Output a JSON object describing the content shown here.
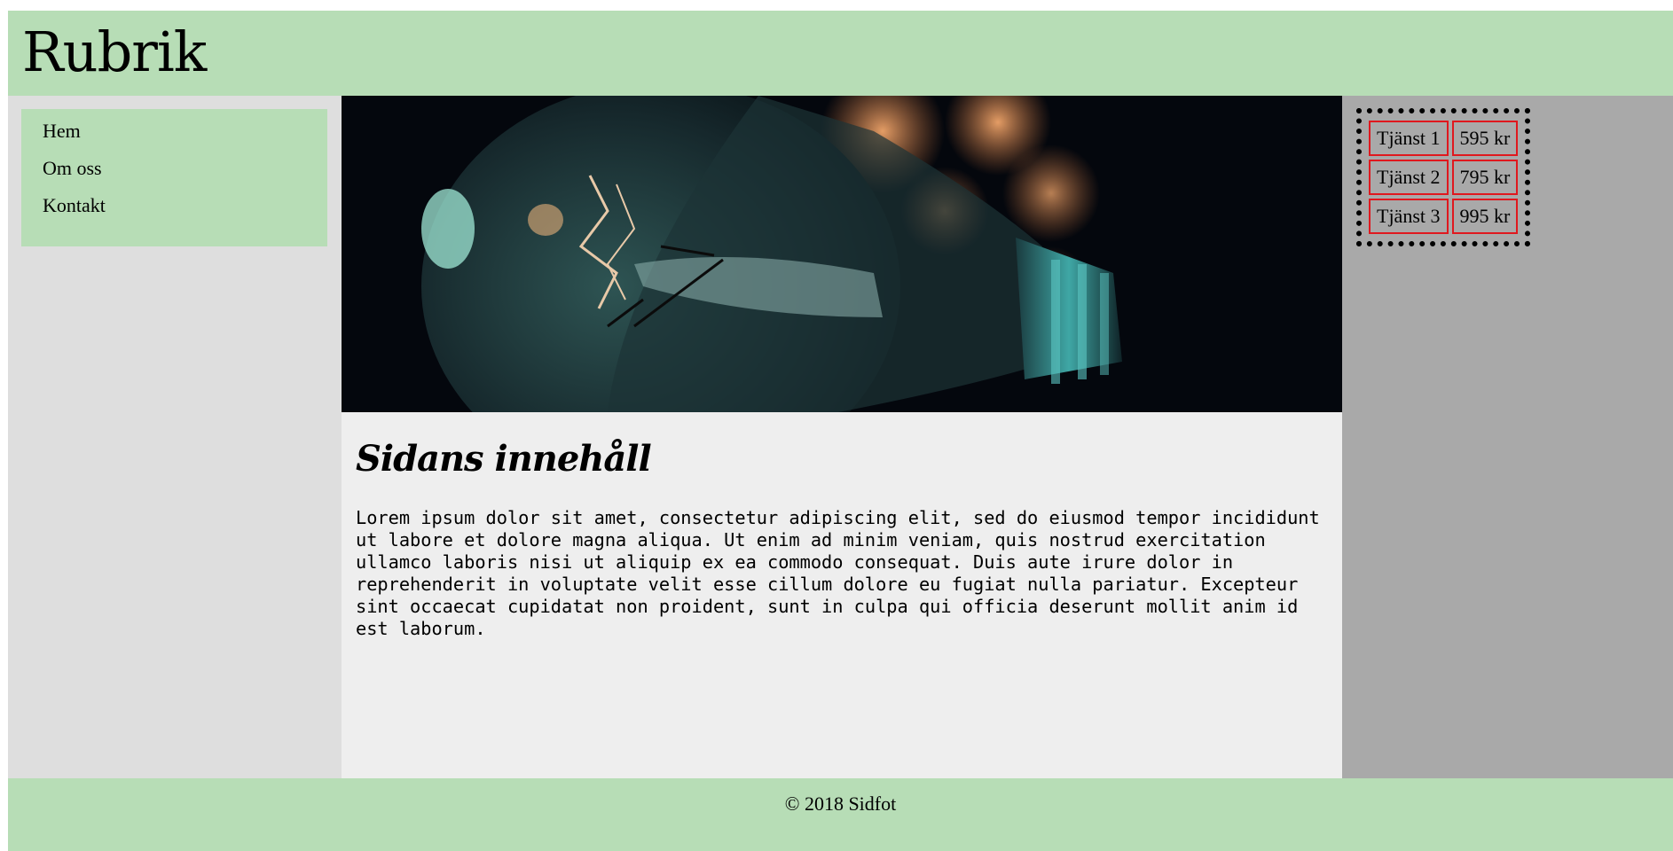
{
  "header": {
    "title": "Rubrik"
  },
  "nav": {
    "items": [
      {
        "label": "Hem"
      },
      {
        "label": "Om oss"
      },
      {
        "label": "Kontakt"
      }
    ]
  },
  "main": {
    "heading": "Sidans innehåll",
    "body": "Lorem ipsum dolor sit amet, consectetur adipiscing elit, sed do eiusmod tempor incididunt ut labore et dolore magna aliqua. Ut enim ad minim veniam, quis nostrud exercitation ullamco laboris nisi ut aliquip ex ea commodo consequat. Duis aute irure dolor in reprehenderit in voluptate velit esse cillum dolore eu fugiat nulla pariatur. Excepteur sint occaecat cupidatat non proident, sunt in culpa qui officia deserunt mollit anim id est laborum."
  },
  "services": [
    {
      "name": "Tjänst 1",
      "price": "595 kr"
    },
    {
      "name": "Tjänst 2",
      "price": "795 kr"
    },
    {
      "name": "Tjänst 3",
      "price": "995 kr"
    }
  ],
  "footer": {
    "text": "© 2018 Sidfot"
  },
  "colors": {
    "header_bg": "#b7ddb6",
    "nav_bg": "#dedede",
    "main_bg": "#eeeeee",
    "aside_bg": "#a9a9a9",
    "table_cell_border": "#e0181e"
  }
}
